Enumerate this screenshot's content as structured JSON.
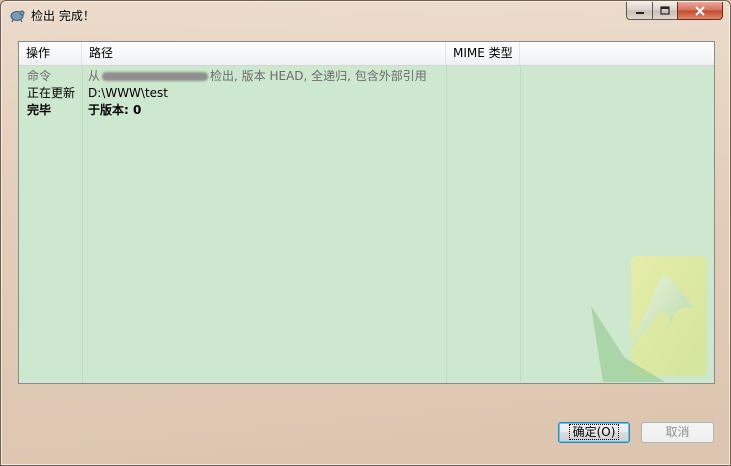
{
  "window": {
    "title": "检出 完成！",
    "icon": "tortoisesvn-icon"
  },
  "list": {
    "columns": [
      "操作",
      "路径",
      "MIME 类型",
      ""
    ],
    "rows": [
      {
        "action": "命令",
        "path_prefix": "从",
        "path_suffix": "检出, 版本 HEAD, 全递归, 包含外部引用",
        "style": "gray"
      },
      {
        "action": "正在更新",
        "path": "D:\\WWW\\test",
        "style": "normal"
      },
      {
        "action": "完毕",
        "path": "于版本: 0",
        "style": "bold"
      }
    ]
  },
  "buttons": {
    "ok": "确定(O)",
    "cancel": "取消"
  },
  "colors": {
    "list_background": "#cde8cf",
    "ok_border": "#3c7fb1"
  }
}
